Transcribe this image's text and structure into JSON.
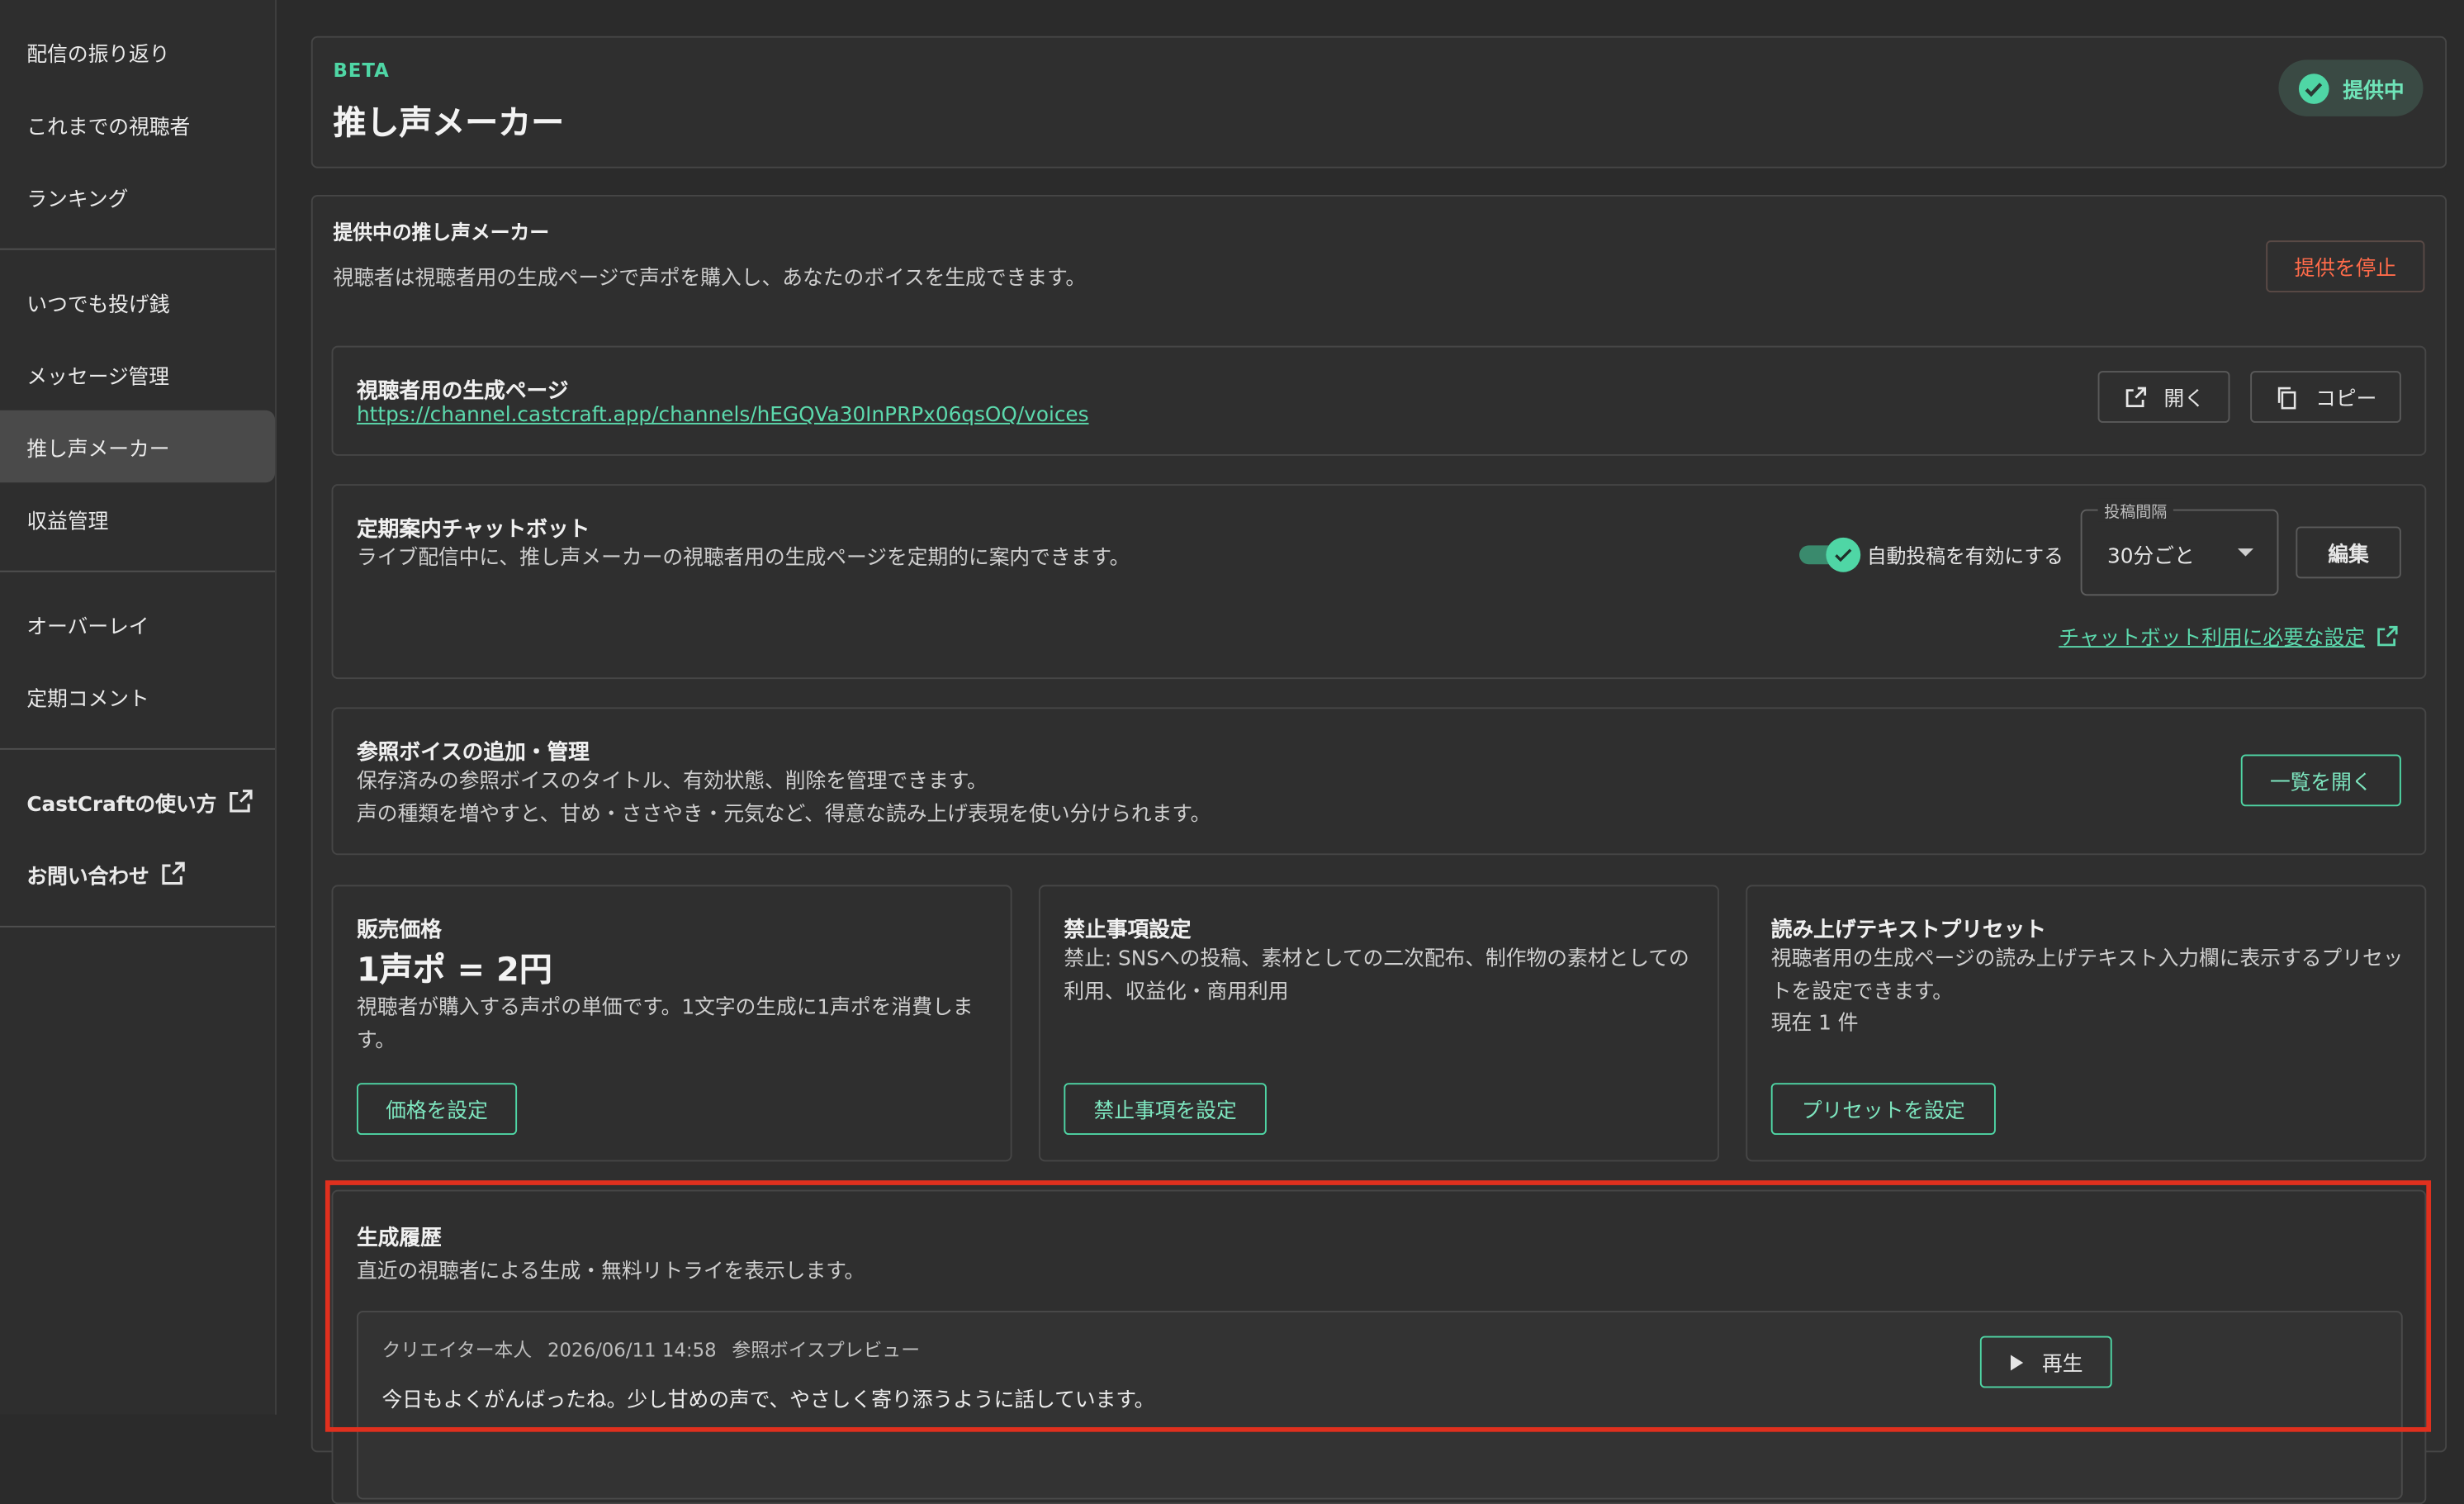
{
  "sidebar": {
    "groups": [
      [
        "配信の振り返り",
        "これまでの視聴者",
        "ランキング"
      ],
      [
        "いつでも投げ銭",
        "メッセージ管理",
        "推し声メーカー",
        "収益管理"
      ],
      [
        "オーバーレイ",
        "定期コメント"
      ],
      [
        "CastCraftの使い方",
        "お問い合わせ"
      ]
    ]
  },
  "header": {
    "badge": "BETA",
    "title": "推し声メーカー",
    "status": "提供中"
  },
  "provider": {
    "title": "提供中の推し声メーカー",
    "desc": "視聴者は視聴者用の生成ページで声ポを購入し、あなたのボイスを生成できます。",
    "stop_button": "提供を停止"
  },
  "viewer_page": {
    "title": "視聴者用の生成ページ",
    "url": "https://channel.castcraft.app/channels/hEGQVa30InPRPx06qsOQ/voices",
    "open_button": "開く",
    "copy_button": "コピー"
  },
  "chatbot": {
    "title": "定期案内チャットボット",
    "desc": "ライブ配信中に、推し声メーカーの視聴者用の生成ページを定期的に案内できます。",
    "toggle_label": "自動投稿を有効にする",
    "interval_label": "投稿間隔",
    "interval_value": "30分ごと",
    "edit_button": "編集",
    "settings_link": "チャットボット利用に必要な設定"
  },
  "reference": {
    "title": "参照ボイスの追加・管理",
    "desc1": "保存済みの参照ボイスのタイトル、有効状態、削除を管理できます。",
    "desc2": "声の種類を増やすと、甘め・ささやき・元気など、得意な読み上げ表現を使い分けられます。",
    "open_list_button": "一覧を開く"
  },
  "price": {
    "title": "販売価格",
    "value": "1声ポ = 2円",
    "desc": "視聴者が購入する声ポの単価です。1文字の生成に1声ポを消費します。",
    "button": "価格を設定"
  },
  "prohibited": {
    "title": "禁止事項設定",
    "desc": "禁止: SNSへの投稿、素材としての二次配布、制作物の素材としての利用、収益化・商用利用",
    "button": "禁止事項を設定"
  },
  "preset": {
    "title": "読み上げテキストプリセット",
    "desc": "視聴者用の生成ページの読み上げテキスト入力欄に表示するプリセットを設定できます。",
    "count": "現在 1 件",
    "button": "プリセットを設定"
  },
  "history": {
    "title": "生成履歴",
    "desc": "直近の視聴者による生成・無料リトライを表示します。",
    "entries": [
      {
        "user": "クリエイター本人",
        "datetime": "2026/06/11 14:58",
        "kind": "参照ボイスプレビュー",
        "text": "今日もよくがんばったね。少し甘めの声で、やさしく寄り添うように話しています。",
        "play_button": "再生"
      }
    ]
  },
  "colors": {
    "accent": "#4fd6a5",
    "danger": "#ff6b4a",
    "highlight": "#e0301e"
  }
}
